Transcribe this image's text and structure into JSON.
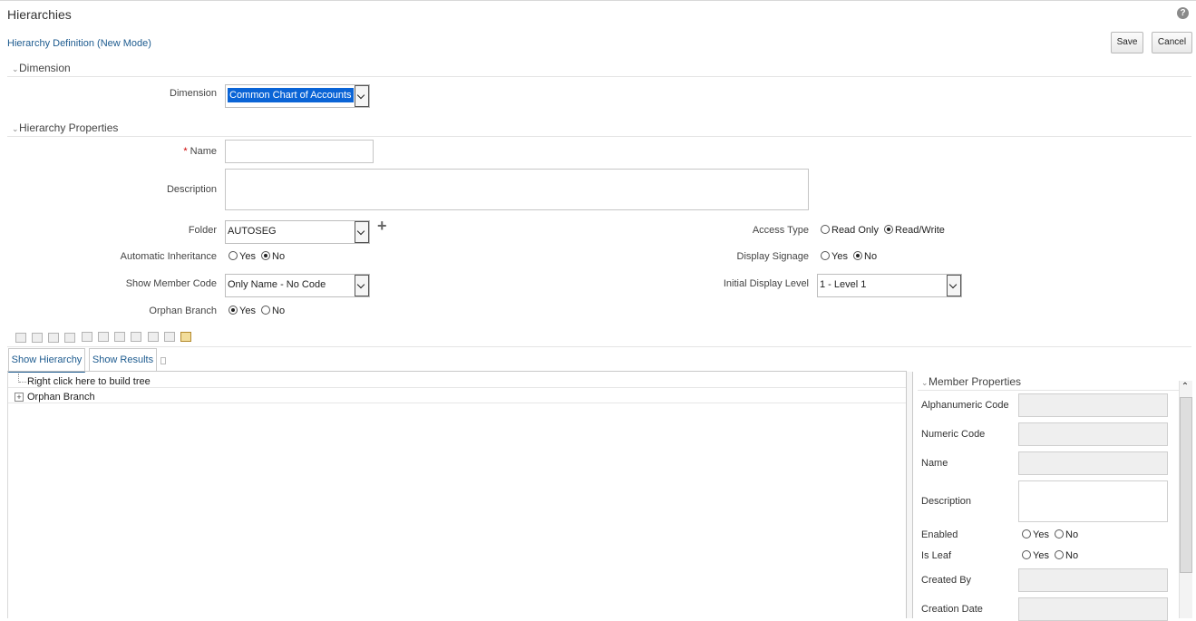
{
  "header": {
    "title": "Hierarchies",
    "subtitle": "Hierarchy Definition (New Mode)",
    "help_glyph": "?",
    "save_label": "Save",
    "cancel_label": "Cancel"
  },
  "dimension_section": {
    "title": "Dimension",
    "field_label": "Dimension",
    "selected": "Common Chart of Accounts"
  },
  "properties_section": {
    "title": "Hierarchy Properties",
    "name_required": "*",
    "name_label": "Name",
    "name_value": "",
    "description_label": "Description",
    "folder_label": "Folder",
    "folder_value": "AUTOSEG",
    "add_folder_glyph": "+",
    "auto_inherit_label": "Automatic Inheritance",
    "auto_inherit_yes": "Yes",
    "auto_inherit_no": "No",
    "show_member_code_label": "Show Member Code",
    "show_member_code_value": "Only Name - No Code",
    "orphan_branch_label": "Orphan Branch",
    "orphan_yes": "Yes",
    "orphan_no": "No",
    "access_type_label": "Access Type",
    "access_read_only": "Read Only",
    "access_read_write": "Read/Write",
    "display_signage_label": "Display Signage",
    "signage_yes": "Yes",
    "signage_no": "No",
    "initial_level_label": "Initial Display Level",
    "initial_level_value": "1 - Level 1"
  },
  "selections": {
    "auto_inherit": "No",
    "orphan_branch": "Yes",
    "access_type": "Read/Write",
    "display_signage": "No"
  },
  "toolbar_icons": [
    "add-child-icon",
    "add-sibling-icon",
    "add-leaf-icon",
    "delete-node-icon",
    "expand-all-icon",
    "collapse-all-icon",
    "expand-branch-icon",
    "collapse-branch-icon",
    "tree-view-icon",
    "list-view-icon",
    "member-properties-icon"
  ],
  "tabs": {
    "show_hierarchy": "Show Hierarchy",
    "show_results": "Show Results"
  },
  "tree": {
    "root_hint": "Right click here to build tree",
    "orphan_node": "Orphan Branch",
    "expander_glyph": "+"
  },
  "member_properties": {
    "title": "Member Properties",
    "alphanumeric_code": "Alphanumeric Code",
    "numeric_code": "Numeric Code",
    "name": "Name",
    "description": "Description",
    "enabled": "Enabled",
    "is_leaf": "Is Leaf",
    "yes": "Yes",
    "no": "No",
    "created_by": "Created By",
    "creation_date": "Creation Date"
  },
  "colors": {
    "link_blue": "#1d5b8f",
    "selection_blue": "#0a64d6",
    "required_red": "#cc0000"
  }
}
